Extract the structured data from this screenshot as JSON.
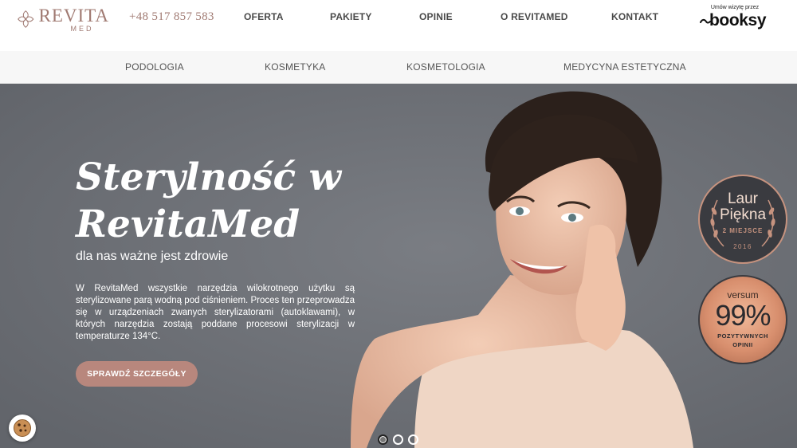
{
  "header": {
    "logo": {
      "name": "REVITA",
      "sub": "MED"
    },
    "phone": "+48 517 857 583",
    "nav": [
      {
        "label": "OFERTA"
      },
      {
        "label": "PAKIETY"
      },
      {
        "label": "OPINIE"
      },
      {
        "label": "O REVITAMED"
      },
      {
        "label": "KONTAKT"
      }
    ],
    "booksy": {
      "small": "Umów wizytę przez",
      "word": "booksy"
    }
  },
  "subnav": {
    "items": [
      {
        "label": "PODOLOGIA"
      },
      {
        "label": "KOSMETYKA"
      },
      {
        "label": "KOSMETOLOGIA"
      },
      {
        "label": "MEDYCYNA ESTETYCZNA"
      }
    ]
  },
  "hero": {
    "title_line1": "Sterylność w",
    "title_line2": "RevitaMed",
    "subtitle": "dla nas ważne jest zdrowie",
    "body": "W RevitaMed wszystkie narzędzia wilokrotnego użytku są sterylizowane parą wodną pod ciśnieniem. Proces ten przeprowadza się w urządzeniach zwanych sterylizatorami (autoklawami), w których narzędzia zostają poddane procesowi sterylizacji w temperaturze 134°C.",
    "button": "SPRAWDŹ SZCZEGÓŁY",
    "slides": {
      "count": 3,
      "active": 0
    }
  },
  "badges": {
    "laur": {
      "line1": "Laur",
      "line2": "Piękna",
      "place": "2 MIEJSCE",
      "year": "2016"
    },
    "versum": {
      "brand": "versum",
      "percent": "99%",
      "line1": "POZYTYWNYCH",
      "line2": "OPINII"
    }
  },
  "colors": {
    "brand": "#a07a72",
    "button": "#b8877d",
    "hero_bg": "#6e7177"
  }
}
